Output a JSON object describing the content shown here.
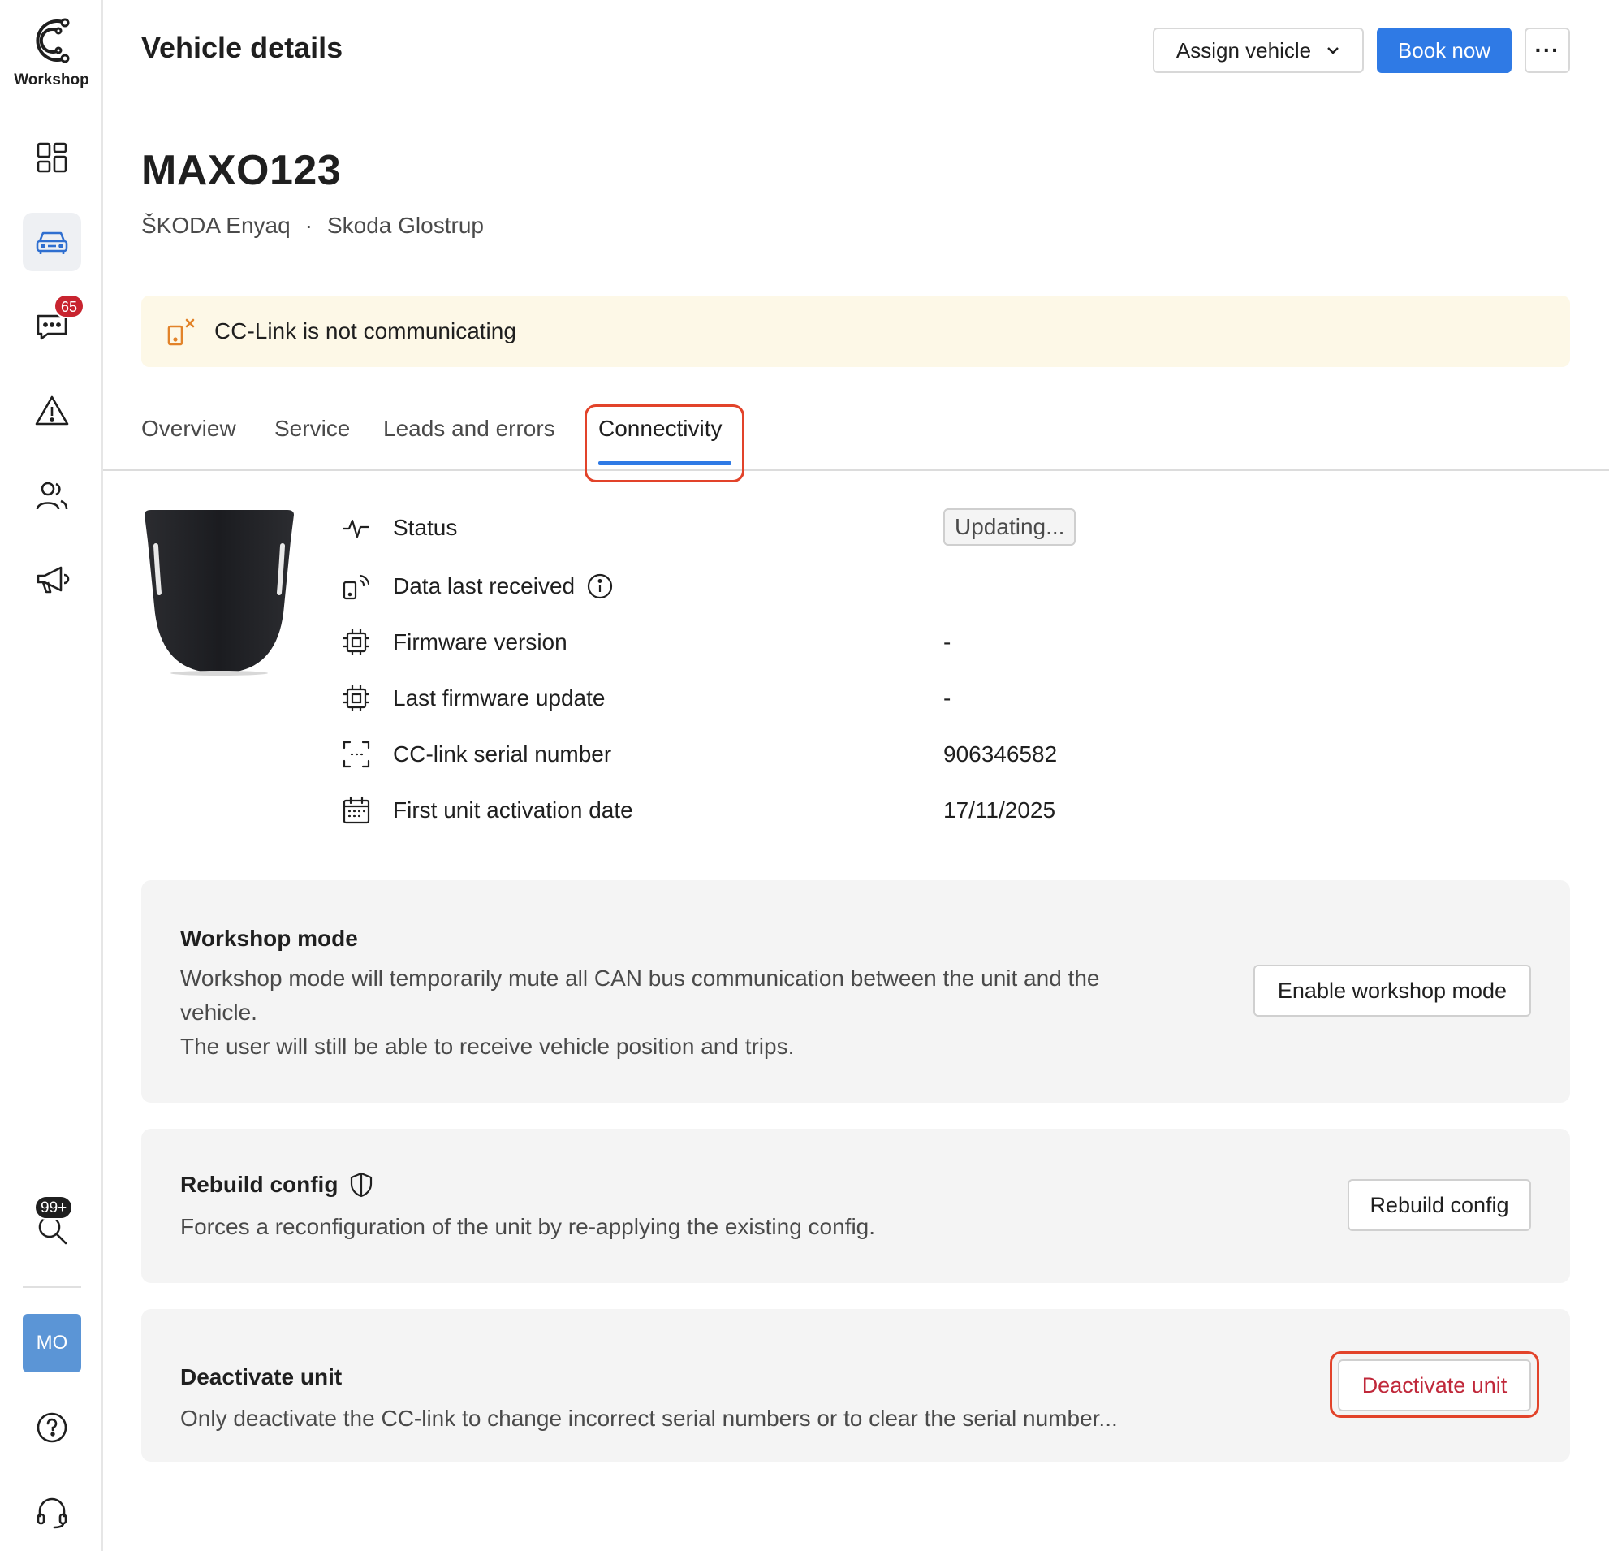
{
  "app": {
    "name": "Workshop"
  },
  "sidebar": {
    "items": [
      {
        "icon": "dashboard-icon"
      },
      {
        "icon": "car-icon",
        "active": true
      },
      {
        "icon": "chat-icon",
        "badge": "65"
      },
      {
        "icon": "warning-icon"
      },
      {
        "icon": "users-icon"
      },
      {
        "icon": "megaphone-icon"
      }
    ],
    "search_badge": "99+",
    "avatar_initials": "MO"
  },
  "header": {
    "title": "Vehicle details",
    "assign_label": "Assign vehicle",
    "book_label": "Book now",
    "more_label": "···"
  },
  "vehicle": {
    "plate": "MAXO123",
    "model": "ŠKODA Enyaq",
    "separator": "·",
    "dealer": "Skoda Glostrup"
  },
  "alert": {
    "text": "CC-Link is not communicating"
  },
  "tabs": [
    {
      "label": "Overview"
    },
    {
      "label": "Service"
    },
    {
      "label": "Leads and errors"
    },
    {
      "label": "Connectivity",
      "active": true
    }
  ],
  "details": {
    "status": {
      "label": "Status",
      "value": "Updating..."
    },
    "data_last_received": {
      "label": "Data last received",
      "value": ""
    },
    "firmware_version": {
      "label": "Firmware version",
      "value": "-"
    },
    "last_firmware_update": {
      "label": "Last firmware update",
      "value": "-"
    },
    "serial_number": {
      "label": "CC-link serial number",
      "value": "906346582"
    },
    "activation_date": {
      "label": "First unit activation date",
      "value": "17/11/2025"
    }
  },
  "cards": {
    "workshop_mode": {
      "title": "Workshop mode",
      "desc_line1": "Workshop mode will temporarily mute all CAN bus communication between the unit and the vehicle.",
      "desc_line2": "The user will still be able to receive vehicle position and trips.",
      "button": "Enable workshop mode"
    },
    "rebuild_config": {
      "title": "Rebuild config",
      "desc": "Forces a reconfiguration of the unit by re-applying the existing config.",
      "button": "Rebuild config"
    },
    "deactivate_unit": {
      "title": "Deactivate unit",
      "desc": "Only deactivate the CC-link to change incorrect serial numbers or to clear the serial number...",
      "button": "Deactivate unit"
    }
  },
  "colors": {
    "accent": "#2f7ae5",
    "alert_bg": "#fdf8e7",
    "alert_icon": "#e2832a",
    "highlight": "#e2432a",
    "danger": "#c0283a"
  }
}
